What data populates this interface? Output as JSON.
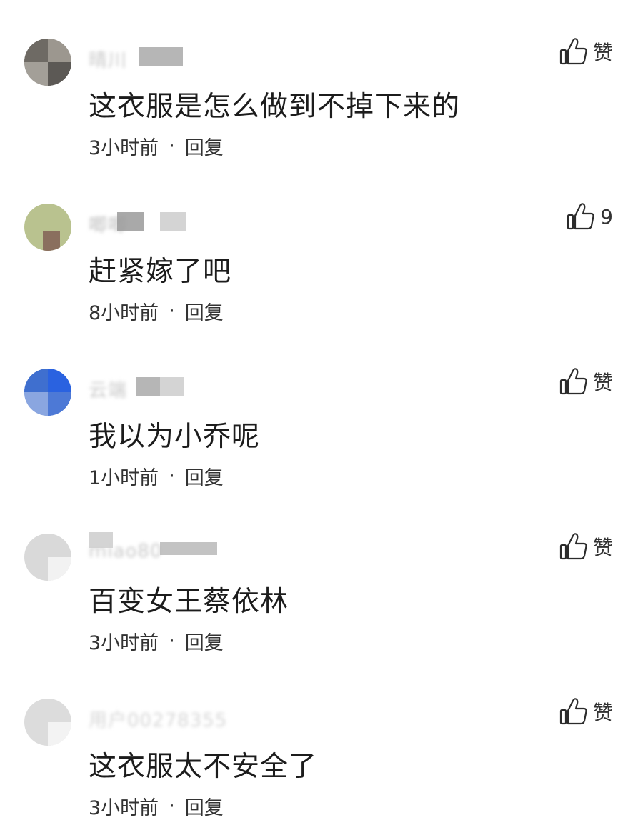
{
  "comments": [
    {
      "text": "这衣服是怎么做到不掉下来的",
      "time": "3小时前",
      "reply": "回复",
      "like": "赞",
      "avatar_color": "#6e6a64"
    },
    {
      "text": "赶紧嫁了吧",
      "time": "8小时前",
      "reply": "回复",
      "like": "9",
      "avatar_color": "#b9c28f"
    },
    {
      "text": "我以为小乔呢",
      "time": "1小时前",
      "reply": "回复",
      "like": "赞",
      "avatar_color": "#3a6fd8"
    },
    {
      "text": "百变女王蔡依林",
      "time": "3小时前",
      "reply": "回复",
      "like": "赞",
      "avatar_color": "#d9d9d9"
    },
    {
      "text": "这衣服太不安全了",
      "time": "3小时前",
      "reply": "回复",
      "like": "赞",
      "avatar_color": "#dcdcdc"
    }
  ],
  "separator": "·"
}
